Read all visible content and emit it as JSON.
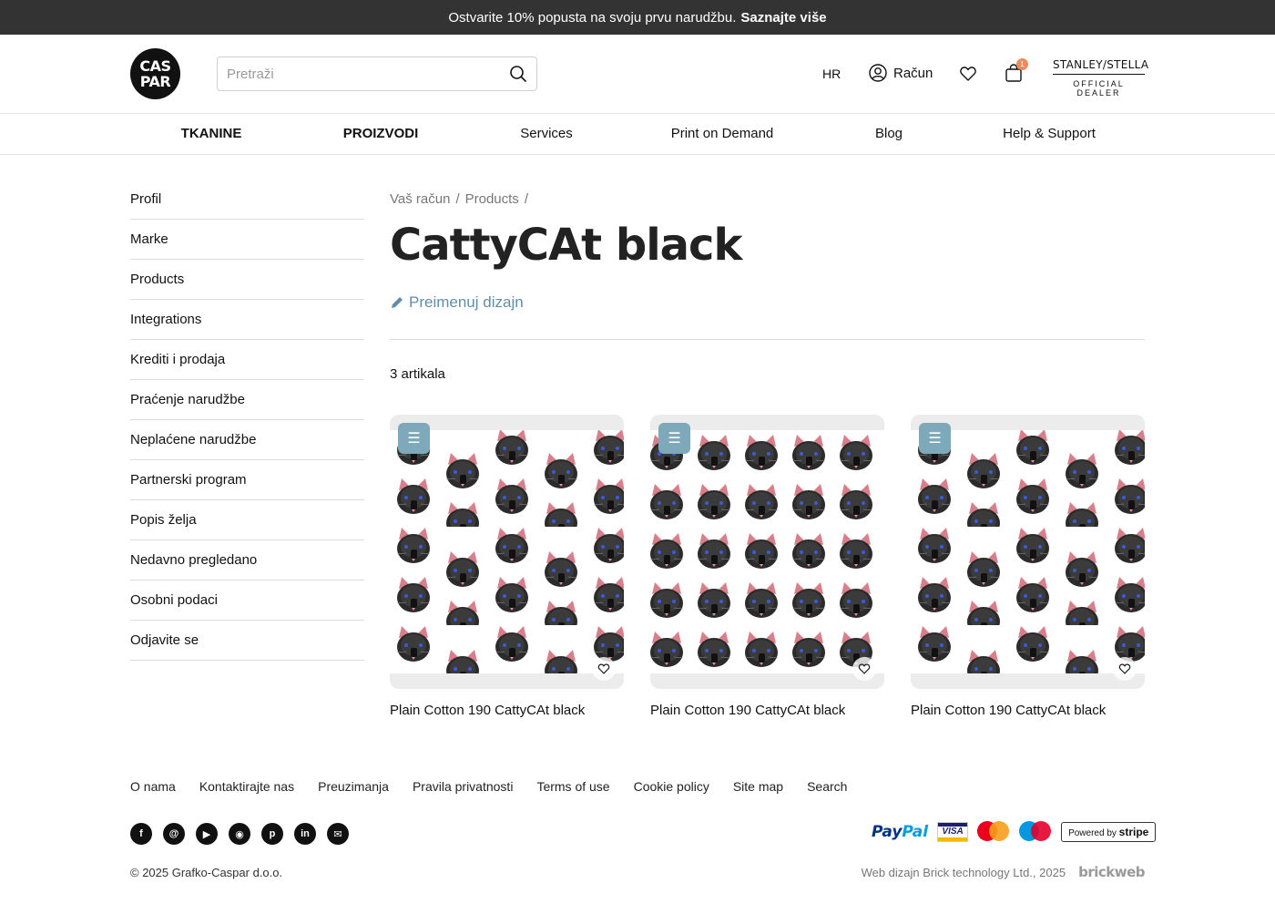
{
  "promo": {
    "text": "Ostvarite 10% popusta na svoju prvu narudžbu.",
    "link": "Saznajte više"
  },
  "header": {
    "logo_top": "CAS",
    "logo_bottom": "PAR",
    "search_placeholder": "Pretraži",
    "language": "HR",
    "account_label": "Račun",
    "cart_count": "1",
    "dealer_brand": "STANLEY/STELLA",
    "dealer_sub": "OFFICIAL DEALER"
  },
  "nav": {
    "items": [
      {
        "label": "TKANINE"
      },
      {
        "label": "PROIZVODI"
      },
      {
        "label": "Services"
      },
      {
        "label": "Print on Demand"
      },
      {
        "label": "Blog"
      },
      {
        "label": "Help & Support"
      }
    ]
  },
  "sidebar": {
    "items": [
      {
        "label": "Profil"
      },
      {
        "label": "Marke"
      },
      {
        "label": "Products"
      },
      {
        "label": "Integrations"
      },
      {
        "label": "Krediti i prodaja"
      },
      {
        "label": "Praćenje narudžbe"
      },
      {
        "label": "Neplaćene narudžbe"
      },
      {
        "label": "Partnerski program"
      },
      {
        "label": "Popis želja"
      },
      {
        "label": "Nedavno pregledano"
      },
      {
        "label": "Osobni podaci"
      },
      {
        "label": "Odjavite se"
      }
    ]
  },
  "main": {
    "breadcrumb": [
      {
        "label": "Vaš račun"
      },
      {
        "label": "Products"
      }
    ],
    "breadcrumb_sep": "/",
    "title": "CattyCAt black",
    "rename_label": "Preimenuj dizajn",
    "count_label": "3 artikala",
    "products": [
      {
        "name": "Plain Cotton 190 CattyCAt black"
      },
      {
        "name": "Plain Cotton 190 CattyCAt black"
      },
      {
        "name": "Plain Cotton 190 CattyCAt black"
      }
    ]
  },
  "footer": {
    "links": [
      {
        "label": "O nama"
      },
      {
        "label": "Kontaktirajte nas"
      },
      {
        "label": "Preuzimanja"
      },
      {
        "label": "Pravila privatnosti"
      },
      {
        "label": "Terms of use"
      },
      {
        "label": "Cookie policy"
      },
      {
        "label": "Site map"
      },
      {
        "label": "Search"
      }
    ],
    "socials": [
      "facebook-icon",
      "threads-icon",
      "youtube-icon",
      "instagram-icon",
      "pinterest-icon",
      "linkedin-icon",
      "email-icon"
    ],
    "payments": {
      "paypal_a": "Pay",
      "paypal_b": "Pal",
      "visa": "VISA",
      "stripe_prefix": "Powered by",
      "stripe_brand": "stripe"
    },
    "copyright": "© 2025 Grafko-Caspar d.o.o.",
    "credit": "Web dizajn Brick technology Ltd., 2025",
    "credit_brand": "brickweb"
  },
  "colors": {
    "accent": "#5f8ea8",
    "menu_button": "#7ea9bb",
    "promo_bg": "#333333",
    "cart_badge": "#f08a5d"
  }
}
